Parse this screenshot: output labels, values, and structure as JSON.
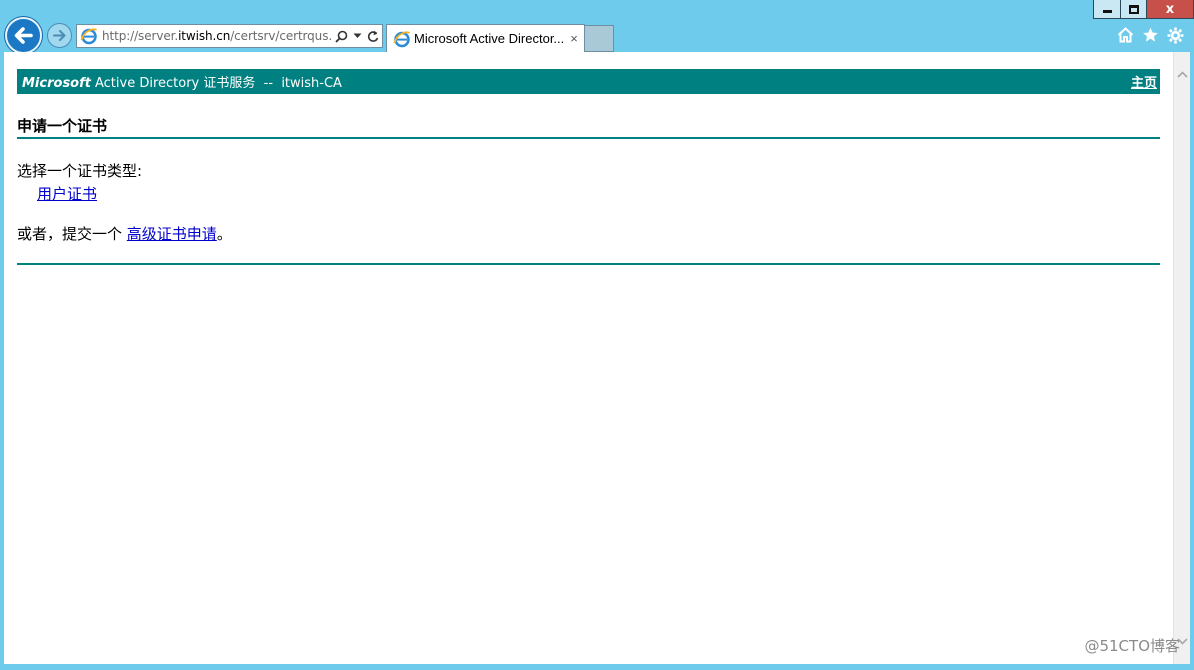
{
  "browser": {
    "address_url": "http://server.itwish.cn/certsrv/certrqus.a",
    "address_url_parts": [
      "http://server.",
      "itwish.cn",
      "/certsrv/certrqus.a"
    ],
    "tab_title": "Microsoft Active Director...",
    "tab_close_glyph": "×",
    "window_controls": {
      "close_glyph": "x"
    }
  },
  "page": {
    "header": {
      "brand": "Microsoft",
      "service_name": "Active Directory 证书服务",
      "separator": "--",
      "ca_name": "itwish-CA",
      "home_link": "主页"
    },
    "section_title": "申请一个证书",
    "prompt": "选择一个证书类型:",
    "cert_types": [
      {
        "label": "用户证书"
      }
    ],
    "alternative": {
      "prefix": "或者，提交一个",
      "link": "高级证书申请",
      "suffix": "。"
    }
  },
  "watermark": "@51CTO博客",
  "colors": {
    "accent": "#008080",
    "link": "#0000cc",
    "frame": "#6ecbec",
    "close": "#c7504a"
  }
}
